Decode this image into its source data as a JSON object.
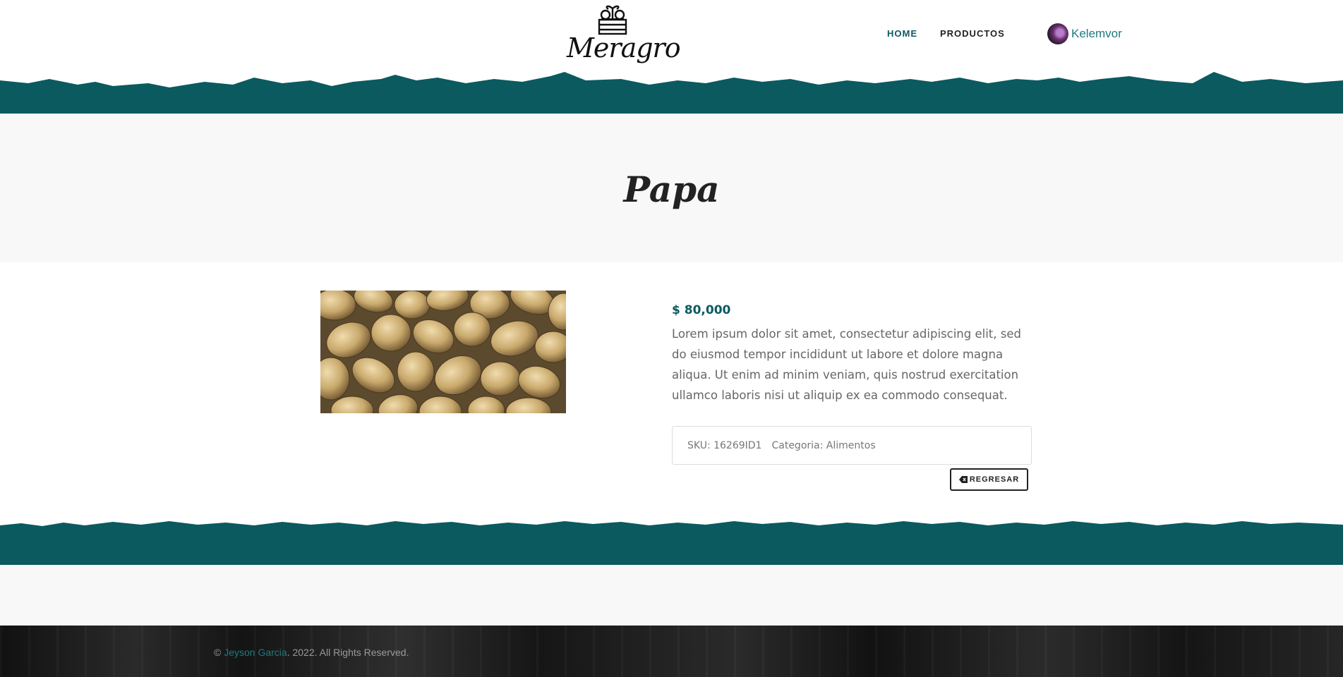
{
  "header": {
    "logo_text": "Meragro",
    "nav": [
      {
        "label": "HOME",
        "active": true
      },
      {
        "label": "PRODUCTOS",
        "active": false
      }
    ],
    "user": {
      "name": "Kelemvor"
    }
  },
  "page": {
    "title": "Papa"
  },
  "product": {
    "image_alt_icon": "potatoes-image",
    "price": "$ 80,000",
    "description": "Lorem ipsum dolor sit amet, consectetur adipiscing elit, sed do eiusmod tempor incididunt ut labore et dolore magna aliqua. Ut enim ad minim veniam, quis nostrud exercitation ullamco laboris nisi ut aliquip ex ea commodo consequat.",
    "sku_label": "SKU:",
    "sku": "16269ID1",
    "category_label": "Categoria:",
    "category": "Alimentos",
    "back_label": "REGRESAR"
  },
  "footer": {
    "copyright_symbol": "©",
    "author": "Jeyson Garcia",
    "rights": ". 2022. All Rights Reserved."
  },
  "colors": {
    "teal": "#0b5a5f",
    "accent_text": "#1f7a7f",
    "footer_bg": "#1c1c1c"
  }
}
